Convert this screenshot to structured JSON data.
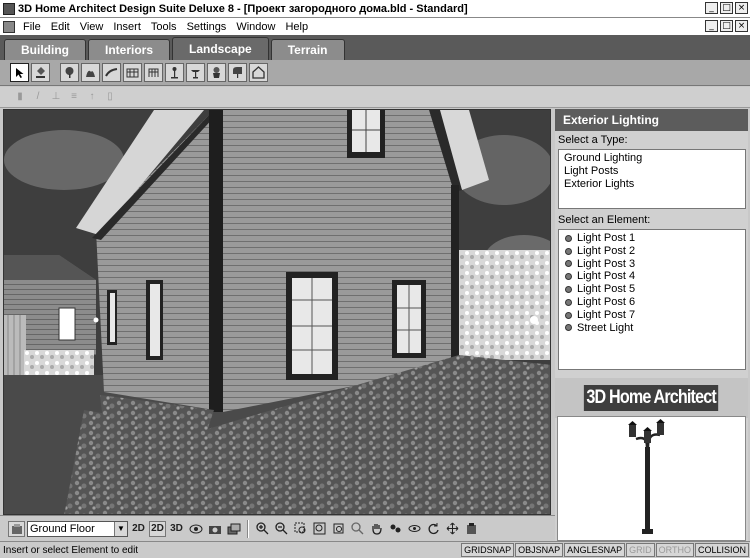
{
  "window": {
    "title": "3D Home Architect Design Suite Deluxe 8 - [Проект загородного дома.bld - Standard]",
    "buttons": [
      "_",
      "□",
      "×"
    ]
  },
  "menu": {
    "items": [
      "File",
      "Edit",
      "View",
      "Insert",
      "Tools",
      "Settings",
      "Window",
      "Help"
    ],
    "buttons": [
      "_",
      "□",
      "×"
    ]
  },
  "tabs": [
    {
      "label": "Building",
      "active": false
    },
    {
      "label": "Interiors",
      "active": false
    },
    {
      "label": "Landscape",
      "active": true
    },
    {
      "label": "Terrain",
      "active": false
    }
  ],
  "toolbar_icons": [
    "select-arrow-icon",
    "paint-bucket-icon",
    "tree-icon",
    "shrub-icon",
    "hedge-icon",
    "fence-icon",
    "gate-icon",
    "lamp-post-icon",
    "birdbath-icon",
    "planter-icon",
    "mailbox-icon",
    "structure-icon"
  ],
  "toolbar2_icons": [
    "edit-1-icon",
    "edit-2-icon",
    "edit-3-icon",
    "edit-4-icon",
    "edit-5-icon",
    "edit-6-icon"
  ],
  "right_panel": {
    "header": "Exterior Lighting",
    "type_label": "Select a Type:",
    "types": [
      "Ground Lighting",
      "Light Posts",
      "Exterior Lights"
    ],
    "element_label": "Select an Element:",
    "elements": [
      "Light Post 1",
      "Light Post 2",
      "Light Post 3",
      "Light Post 4",
      "Light Post 5",
      "Light Post 6",
      "Light Post 7",
      "Street Light"
    ],
    "logo_text": "3D Home Architect"
  },
  "bottom_toolbar": {
    "floor_value": "Ground Floor",
    "view_buttons": [
      "2D",
      "2D",
      "3D"
    ],
    "icons": [
      "eye-icon",
      "camera-icon",
      "layers-icon",
      "zoom-in-icon",
      "zoom-out-icon",
      "zoom-box-icon",
      "zoom-fit-icon",
      "zoom-prev-icon",
      "zoom-scale-icon",
      "pan-hand-icon",
      "walk-icon",
      "orbit-icon",
      "rotate-icon",
      "move-icon",
      "render-icon"
    ]
  },
  "status": {
    "message": "Insert or select Element to edit",
    "cells": [
      {
        "label": "GRIDSNAP",
        "enabled": true
      },
      {
        "label": "OBJSNAP",
        "enabled": true
      },
      {
        "label": "ANGLESNAP",
        "enabled": true
      },
      {
        "label": "GRID",
        "enabled": false
      },
      {
        "label": "ORTHO",
        "enabled": false
      },
      {
        "label": "COLLISION",
        "enabled": true
      }
    ]
  }
}
